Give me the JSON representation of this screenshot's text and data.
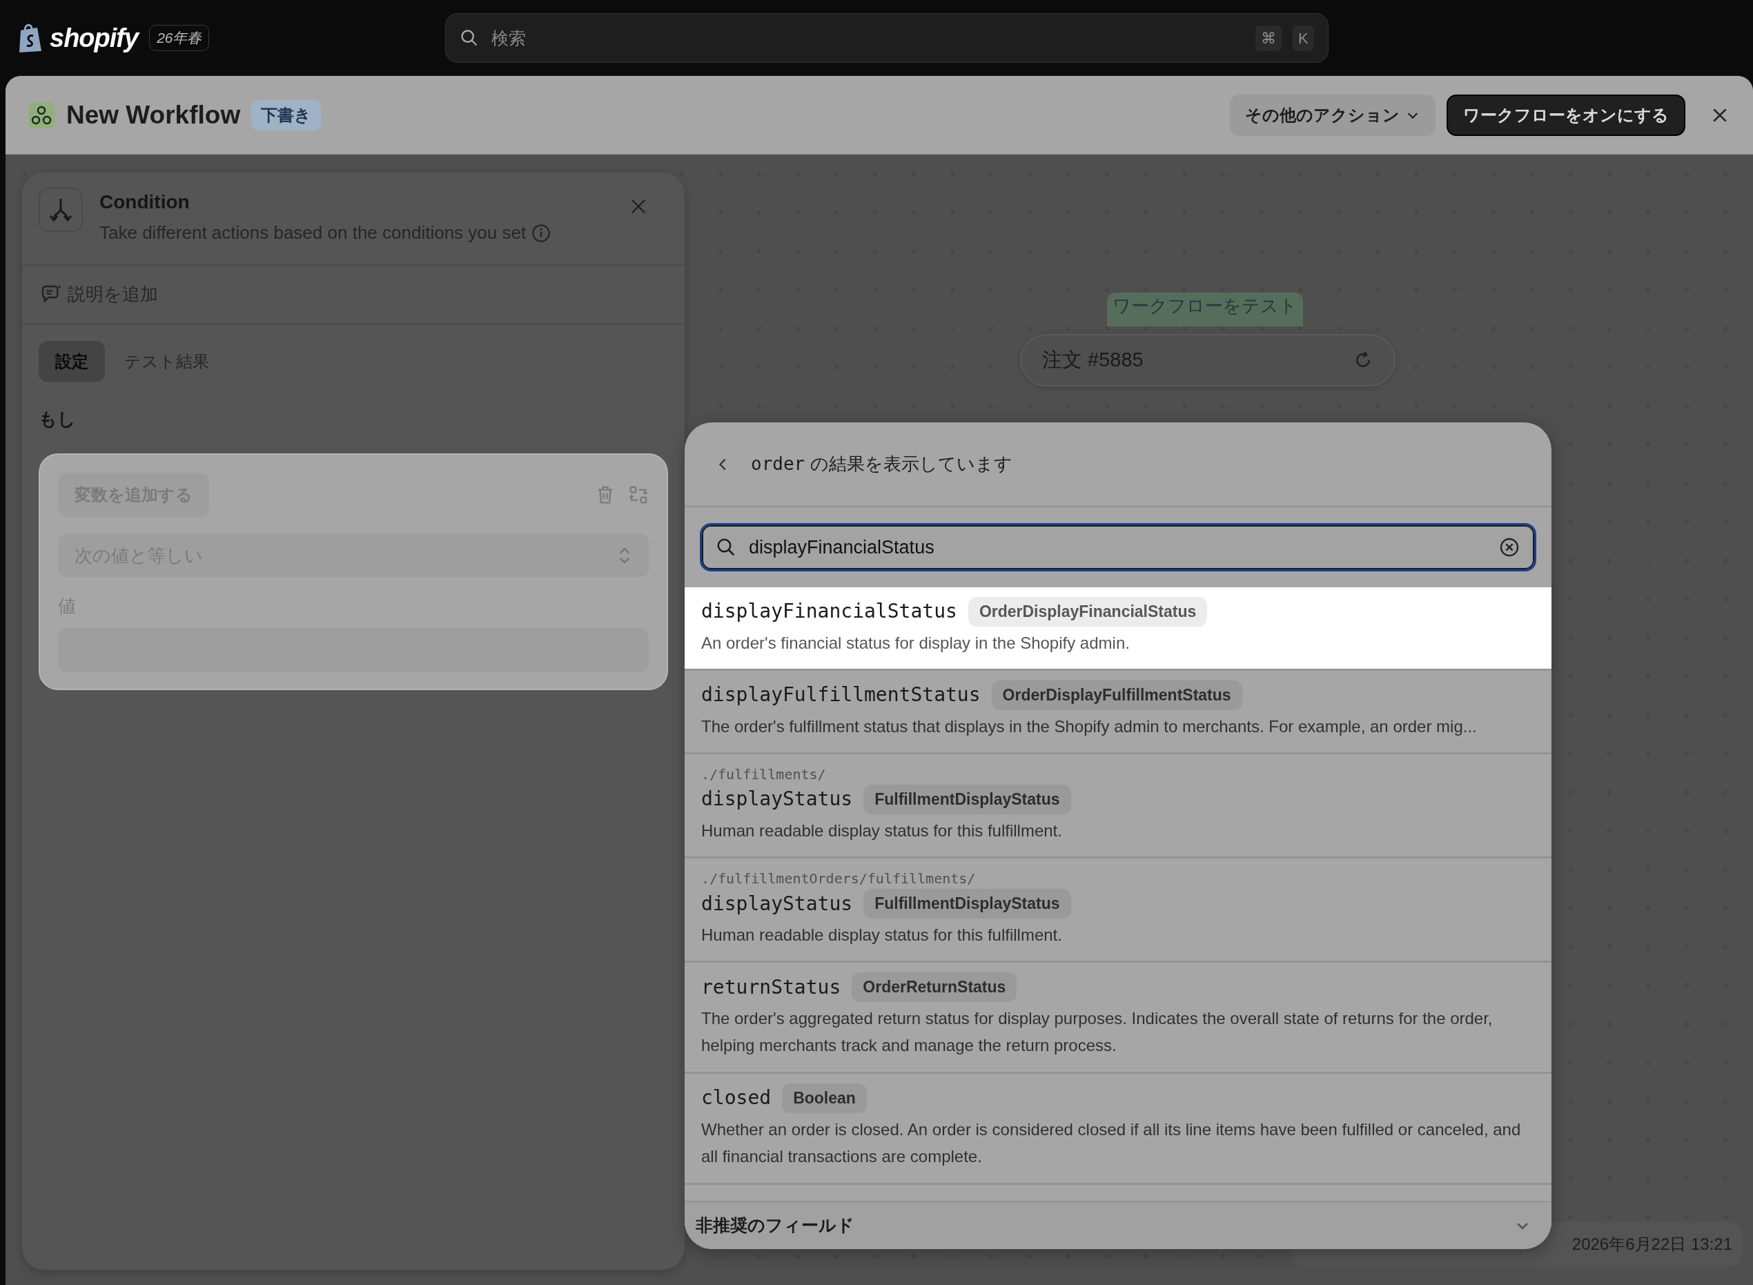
{
  "topbar": {
    "logo_text": "shopify",
    "edition": "26年春",
    "search": {
      "placeholder": "検索"
    },
    "shortcut_keys": [
      "⌘",
      "K"
    ]
  },
  "workflow": {
    "title": "New Workflow",
    "status": "下書き",
    "actions": [
      {
        "label": "その他のアクション",
        "kind": "menu"
      },
      {
        "label": "ワークフローをオンにする",
        "kind": "primary"
      }
    ]
  },
  "side_panel": {
    "title": "Condition",
    "subtitle": "Take different actions based on the conditions you set",
    "add_description": "説明を追加",
    "tabs": [
      {
        "label": "設定",
        "selected": true
      },
      {
        "label": "テスト結果",
        "selected": false
      }
    ],
    "section_label": "もし",
    "rule": {
      "variable_button": "変数を追加する",
      "operator": "次の値と等しい",
      "value_label": "値"
    }
  },
  "canvas": {
    "test_label": "ワークフローをテスト",
    "test_order": "注文 #5885",
    "timestamp": "2026年6月22日 13:21"
  },
  "picker": {
    "scope": "order",
    "heading": "の結果を表示しています",
    "search": {
      "value": "displayFinancialStatus"
    },
    "results": [
      {
        "name": "displayFinancialStatus",
        "type": "OrderDisplayFinancialStatus",
        "description": "An order's financial status for display in the Shopify admin.",
        "selected": true
      },
      {
        "name": "displayFulfillmentStatus",
        "type": "OrderDisplayFulfillmentStatus",
        "description": "The order's fulfillment status that displays in the Shopify admin to merchants. For example, an order mig...",
        "selected": false
      },
      {
        "path": "./fulfillments/",
        "name": "displayStatus",
        "type": "FulfillmentDisplayStatus",
        "description": "Human readable display status for this fulfillment.",
        "selected": false
      },
      {
        "path": "./fulfillmentOrders/fulfillments/",
        "name": "displayStatus",
        "type": "FulfillmentDisplayStatus",
        "description": "Human readable display status for this fulfillment.",
        "selected": false
      },
      {
        "name": "returnStatus",
        "type": "OrderReturnStatus",
        "description": "The order's aggregated return status for display purposes. Indicates the overall state of returns for the order, helping merchants track and manage the return process.",
        "selected": false
      },
      {
        "name": "closed",
        "type": "Boolean",
        "description": "Whether an order is closed. An order is considered closed if all its line items have been fulfilled or canceled, and all financial transactions are complete.",
        "selected": false
      }
    ],
    "footer": "非推奨のフィールド"
  }
}
